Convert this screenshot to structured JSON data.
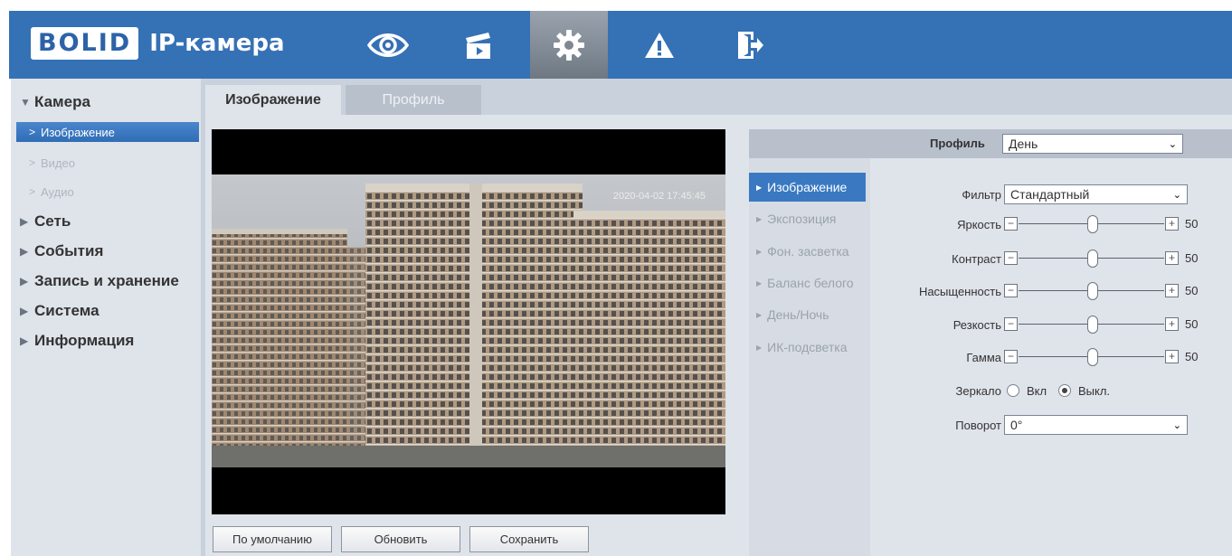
{
  "app": {
    "brand": "BOLID",
    "title": "IP-камера"
  },
  "topnav": [
    {
      "name": "live-view",
      "icon": "eye-icon"
    },
    {
      "name": "playback",
      "icon": "clapperboard-icon"
    },
    {
      "name": "settings",
      "icon": "gear-icon",
      "active": true
    },
    {
      "name": "alarm",
      "icon": "warning-icon"
    },
    {
      "name": "logout",
      "icon": "logout-icon"
    }
  ],
  "sidebar": {
    "camera": "Камера",
    "sub": [
      "Изображение",
      "Видео",
      "Аудио"
    ],
    "groups": [
      "Сеть",
      "События",
      "Запись и хранение",
      "Система",
      "Информация"
    ]
  },
  "tabs": {
    "active": "Изображение",
    "inactive": "Профиль"
  },
  "video": {
    "osd": "2020-04-02 17:45:45"
  },
  "buttons": {
    "default": "По умолчанию",
    "refresh": "Обновить",
    "save": "Сохранить"
  },
  "profile": {
    "label": "Профиль",
    "value": "День"
  },
  "menu": [
    "Изображение",
    "Экспозиция",
    "Фон. засветка",
    "Баланс белого",
    "День/Ночь",
    "ИК-подсветка"
  ],
  "settings": {
    "filter_label": "Фильтр",
    "filter_value": "Стандартный",
    "sliders": [
      {
        "label": "Яркость",
        "value": "50"
      },
      {
        "label": "Контраст",
        "value": "50"
      },
      {
        "label": "Насыщенность",
        "value": "50"
      },
      {
        "label": "Резкость",
        "value": "50"
      },
      {
        "label": "Гамма",
        "value": "50"
      }
    ],
    "mirror_label": "Зеркало",
    "mirror_on": "Вкл",
    "mirror_off": "Выкл.",
    "rotate_label": "Поворот",
    "rotate_value": "0°"
  },
  "colors": {
    "header": "#3571b5",
    "accent": "#3a79c2"
  }
}
